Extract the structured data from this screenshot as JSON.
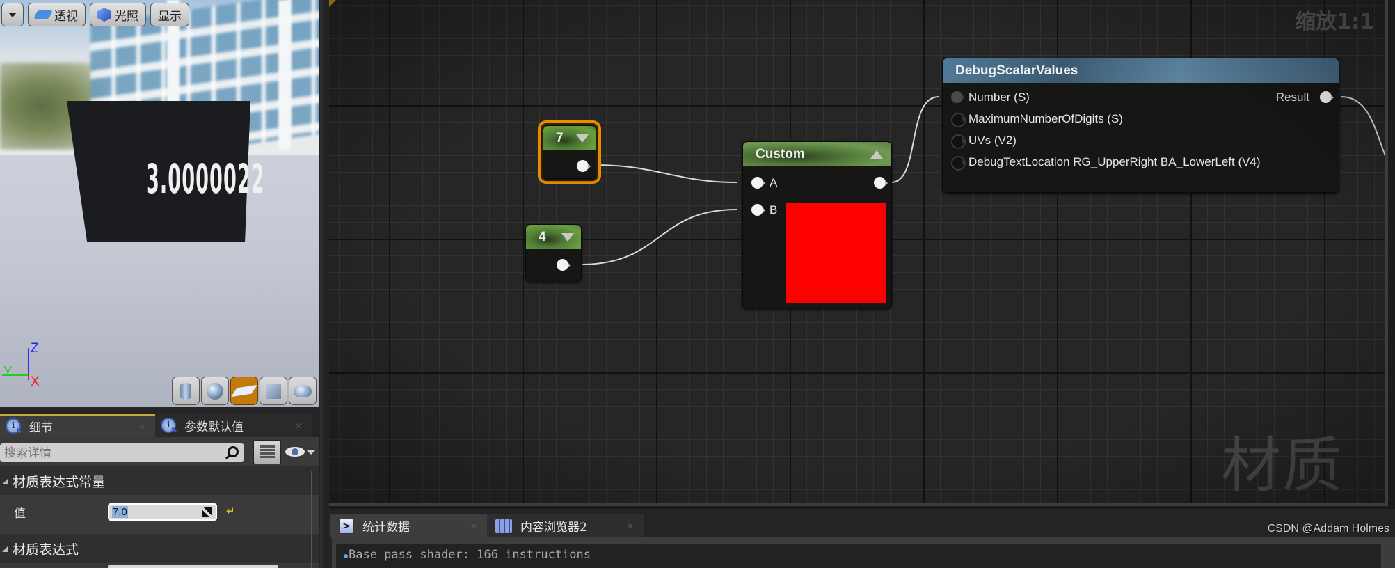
{
  "viewport": {
    "toolbar": {
      "menu_label": "",
      "perspective_label": "透视",
      "lighting_label": "光照",
      "show_label": "显示"
    },
    "mesh_text": "3.0000022",
    "axis": {
      "z": "Z",
      "y": "Y",
      "x": "X"
    },
    "preview_shapes": [
      {
        "name": "cylinder-icon",
        "active": false
      },
      {
        "name": "sphere-icon",
        "active": false
      },
      {
        "name": "plane-icon",
        "active": true
      },
      {
        "name": "cube-icon",
        "active": false
      },
      {
        "name": "teapot-icon",
        "active": false
      }
    ]
  },
  "details": {
    "tabs": [
      {
        "label": "细节",
        "icon": "info-icon",
        "active": true
      },
      {
        "label": "参数默认值",
        "icon": "info-icon",
        "active": false
      }
    ],
    "search_placeholder": "搜索详情",
    "categories": [
      {
        "label": "材质表达式常量"
      },
      {
        "label": "材质表达式"
      }
    ],
    "properties": [
      {
        "label": "值",
        "value": "7.0"
      }
    ]
  },
  "graph": {
    "zoom_label": "缩放1:1",
    "watermark": "材质",
    "nodes": {
      "const7": {
        "title": "7",
        "selected": true
      },
      "const4": {
        "title": "4",
        "selected": false
      },
      "custom": {
        "title": "Custom",
        "inputs": [
          "A",
          "B"
        ],
        "preview_color": "#ff0000"
      },
      "debug": {
        "title": "DebugScalarValues",
        "inputs": [
          "Number (S)",
          "MaximumNumberOfDigits (S)",
          "UVs (V2)",
          "DebugTextLocation RG_UpperRight BA_LowerLeft (V4)"
        ],
        "output": "Result"
      }
    },
    "colors": {
      "selection": "#e88e00",
      "constant_header": "#5f8a45",
      "function_header": "#4f7896",
      "wire": "#d8d8d8"
    }
  },
  "bottom": {
    "tabs": [
      {
        "label": "统计数据",
        "icon": "console-icon",
        "active": true
      },
      {
        "label": "内容浏览器2",
        "icon": "content-browser-icon",
        "active": false
      }
    ],
    "stats": [
      "Base pass shader: 166 instructions"
    ],
    "credit": "CSDN @Addam Holmes"
  }
}
